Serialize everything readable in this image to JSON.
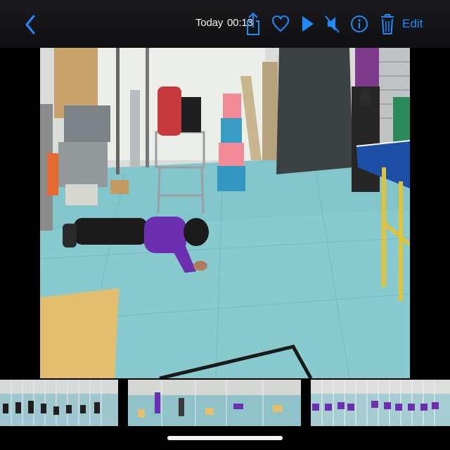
{
  "toolbar": {
    "title": "Today",
    "time": "00:13",
    "edit_label": "Edit",
    "accent_color": "#1e8bff",
    "icons": [
      "back-icon",
      "share-icon",
      "heart-icon",
      "play-icon",
      "mute-icon",
      "info-icon",
      "trash-icon"
    ]
  },
  "scrubber": {
    "segments": 3
  }
}
